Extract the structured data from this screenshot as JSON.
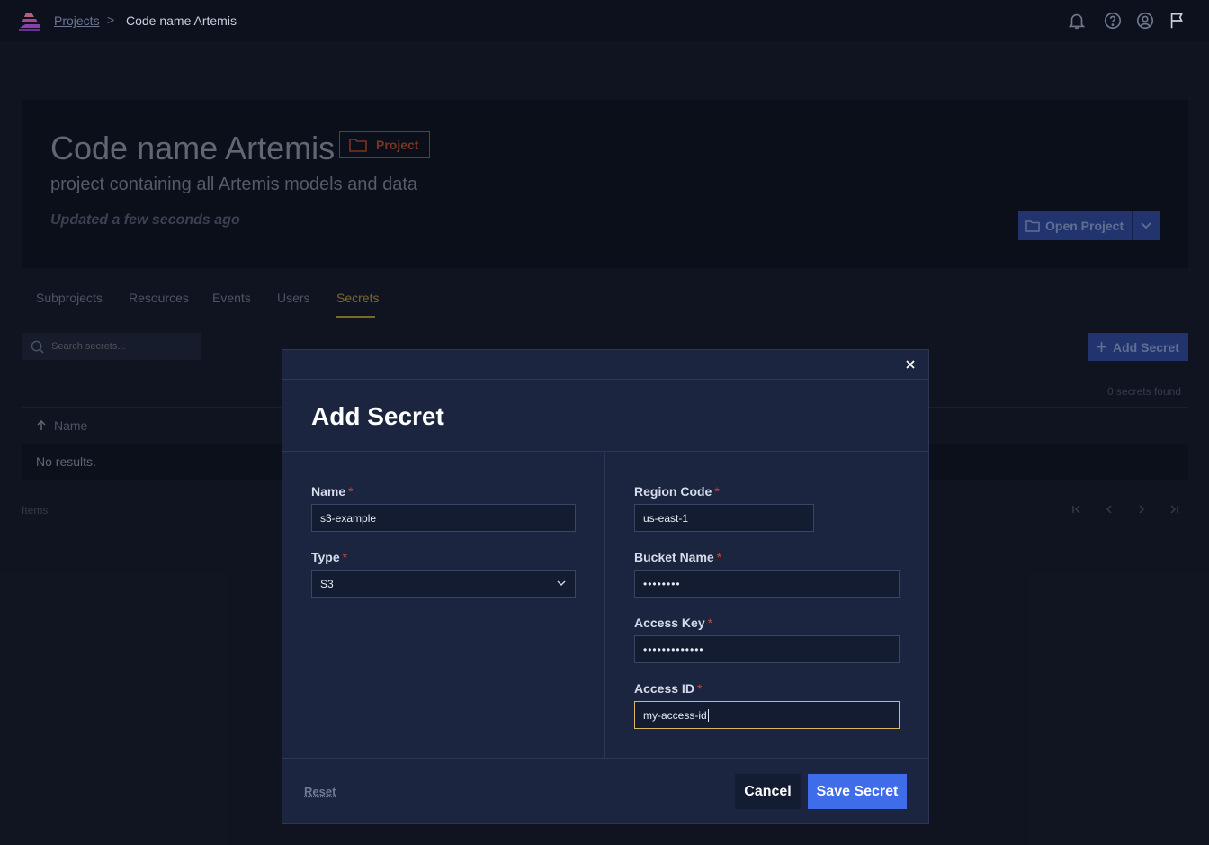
{
  "topbar": {
    "breadcrumb_root": "Projects",
    "breadcrumb_separator": ">",
    "breadcrumb_current": "Code name Artemis",
    "icons": [
      "bell-icon",
      "help-icon",
      "user-circle-icon",
      "flag-icon"
    ]
  },
  "project": {
    "title": "Code name Artemis",
    "badge": "Project",
    "description": "project containing all Artemis models and data",
    "updated": "Updated a few seconds ago",
    "open_button": "Open Project"
  },
  "tabs": [
    {
      "label": "Subprojects"
    },
    {
      "label": "Resources"
    },
    {
      "label": "Events"
    },
    {
      "label": "Users"
    },
    {
      "label": "Secrets",
      "active": true
    }
  ],
  "secrets": {
    "search_placeholder": "Search secrets...",
    "add_button": "Add Secret",
    "found_text": "0 secrets found",
    "column_name": "Name",
    "empty_text": "No results.",
    "items_label": "Items"
  },
  "modal": {
    "title": "Add Secret",
    "name_label": "Name",
    "name_value": "s3-example",
    "type_label": "Type",
    "type_value": "S3",
    "region_label": "Region Code",
    "region_value": "us-east-1",
    "bucket_label": "Bucket Name",
    "bucket_value": "••••••••",
    "access_key_label": "Access Key",
    "access_key_value": "•••••••••••••",
    "access_id_label": "Access ID",
    "access_id_value": "my-access-id",
    "required_mark": "*",
    "reset_label": "Reset",
    "cancel_label": "Cancel",
    "save_label": "Save Secret"
  },
  "colors": {
    "background": "#141a28",
    "modal_bg": "#1b2540",
    "primary": "#3f6ce8",
    "badge_orange": "#b54a2c",
    "active_tab": "#b59a3a",
    "focus_border": "#d8b85a"
  }
}
